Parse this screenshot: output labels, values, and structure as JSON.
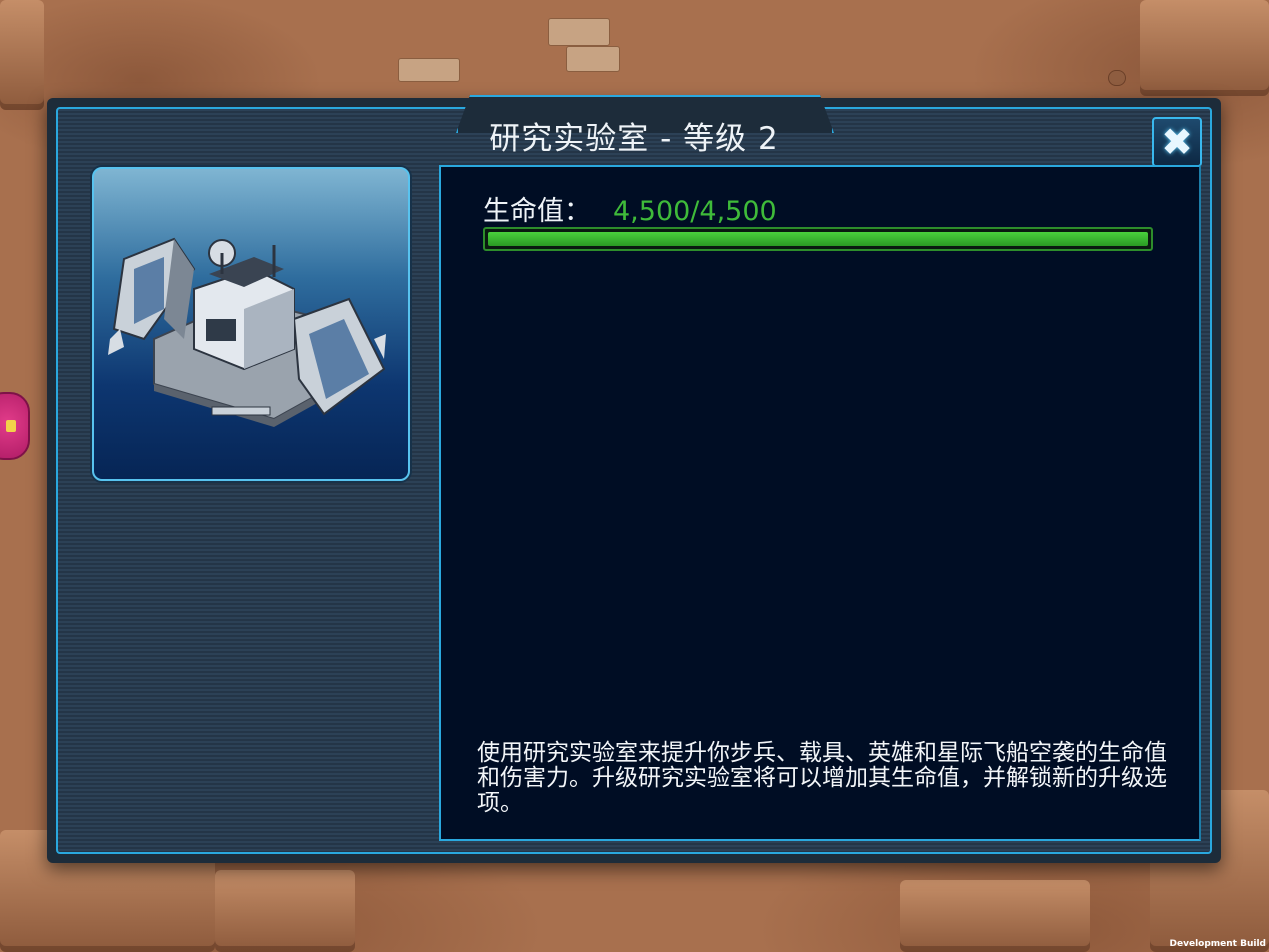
{
  "dialog": {
    "title": "研究实验室 - 等级 2",
    "close_icon": "close-icon"
  },
  "building": {
    "image_icon": "research-lab-building"
  },
  "stats": {
    "hp_label": "生命值：",
    "hp_value": "4,500/4,500",
    "hp_current": 4500,
    "hp_max": 4500,
    "hp_fraction": 1.0,
    "hp_color": "#3fbb3a"
  },
  "description": "使用研究实验室来提升你步兵、载具、英雄和星际飞船空袭的生命值和伤害力。升级研究实验室将可以增加其生命值，并解锁新的升级选项。",
  "footer": {
    "build_label": "Development Build"
  },
  "colors": {
    "frame_accent": "#2aa8de",
    "panel_bg": "#000d24",
    "terrain": "#a8704e"
  }
}
